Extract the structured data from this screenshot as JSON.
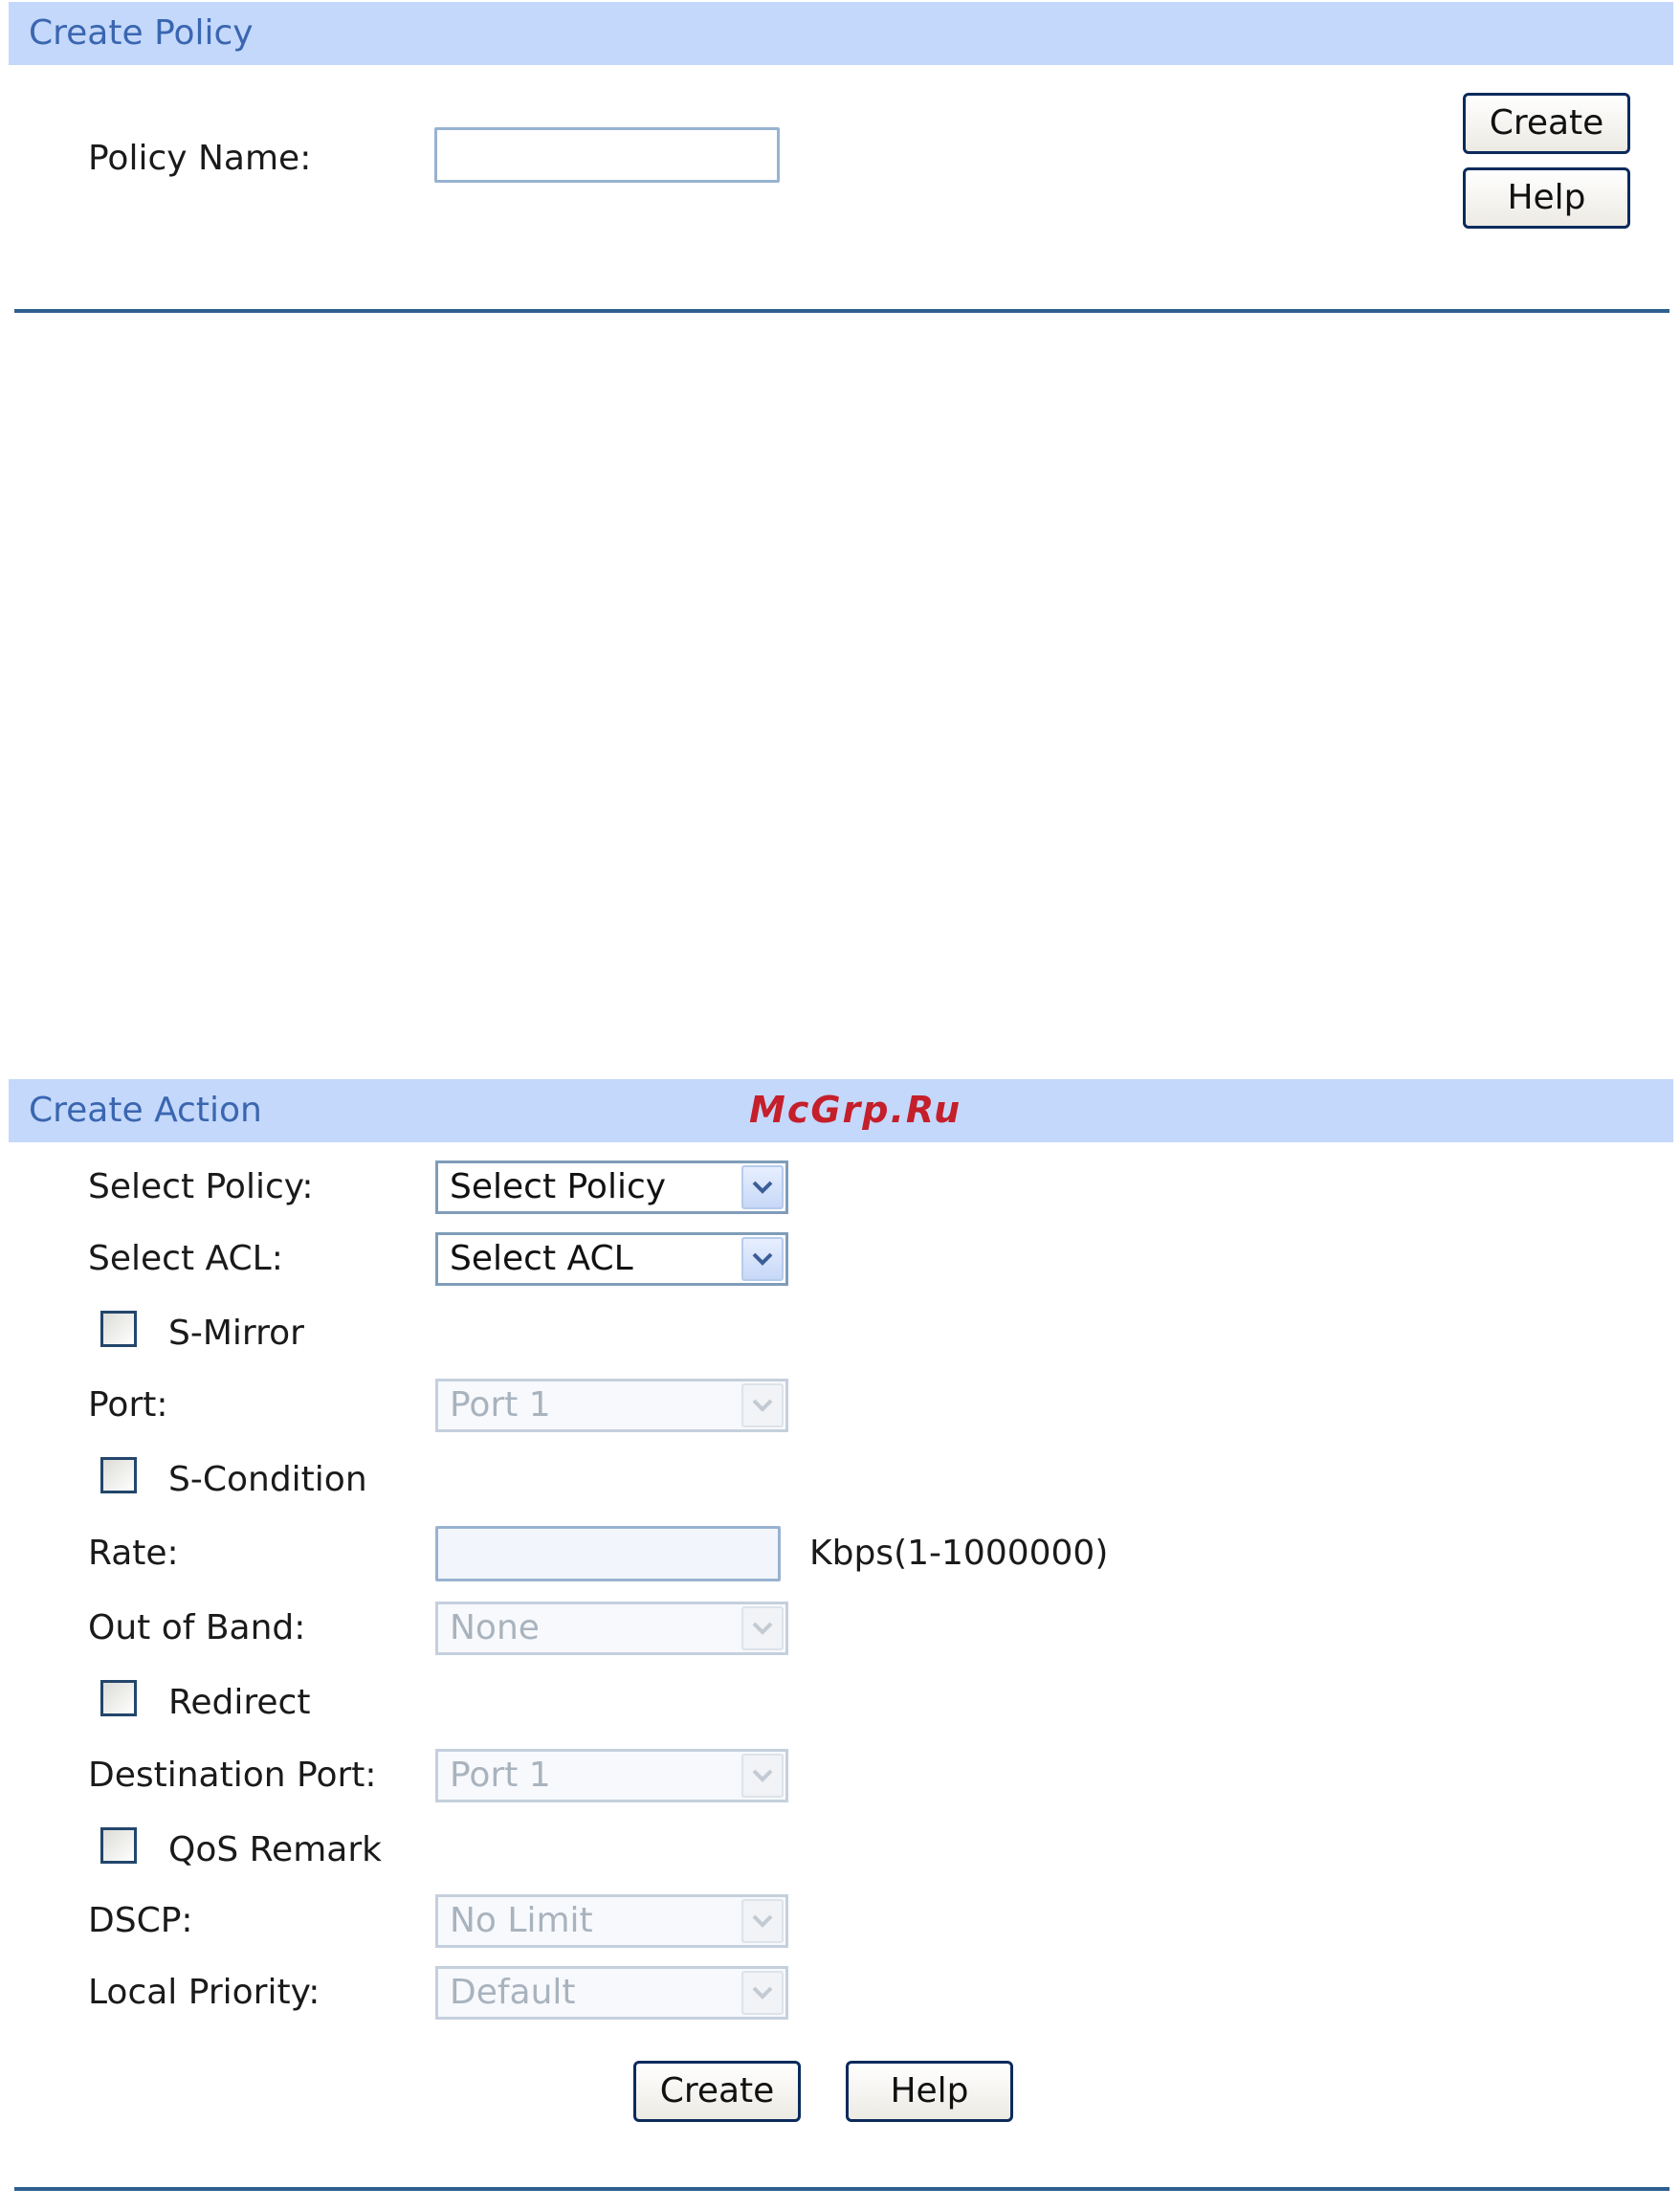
{
  "create_policy": {
    "title": "Create Policy",
    "policy_name_label": "Policy Name:",
    "policy_name_value": "",
    "create_button": "Create",
    "help_button": "Help"
  },
  "watermark": "McGrp.Ru",
  "create_action": {
    "title": "Create Action",
    "select_policy_label": "Select Policy:",
    "select_policy_value": "Select Policy",
    "select_acl_label": "Select ACL:",
    "select_acl_value": "Select ACL",
    "s_mirror_label": "S-Mirror",
    "s_mirror_checked": false,
    "port_label": "Port:",
    "port_value": "Port 1",
    "s_condition_label": "S-Condition",
    "s_condition_checked": false,
    "rate_label": "Rate:",
    "rate_value": "",
    "rate_hint": "Kbps(1-1000000)",
    "out_of_band_label": "Out of Band:",
    "out_of_band_value": "None",
    "redirect_label": "Redirect",
    "redirect_checked": false,
    "destination_port_label": "Destination Port:",
    "destination_port_value": "Port 1",
    "qos_remark_label": "QoS Remark",
    "qos_remark_checked": false,
    "dscp_label": "DSCP:",
    "dscp_value": "No Limit",
    "local_priority_label": "Local Priority:",
    "local_priority_value": "Default",
    "create_button": "Create",
    "help_button": "Help"
  },
  "colors": {
    "header_bg": "#c4d8fb",
    "header_text": "#3a66b0",
    "divider": "#2e5f8e",
    "watermark": "#c41f2a"
  }
}
